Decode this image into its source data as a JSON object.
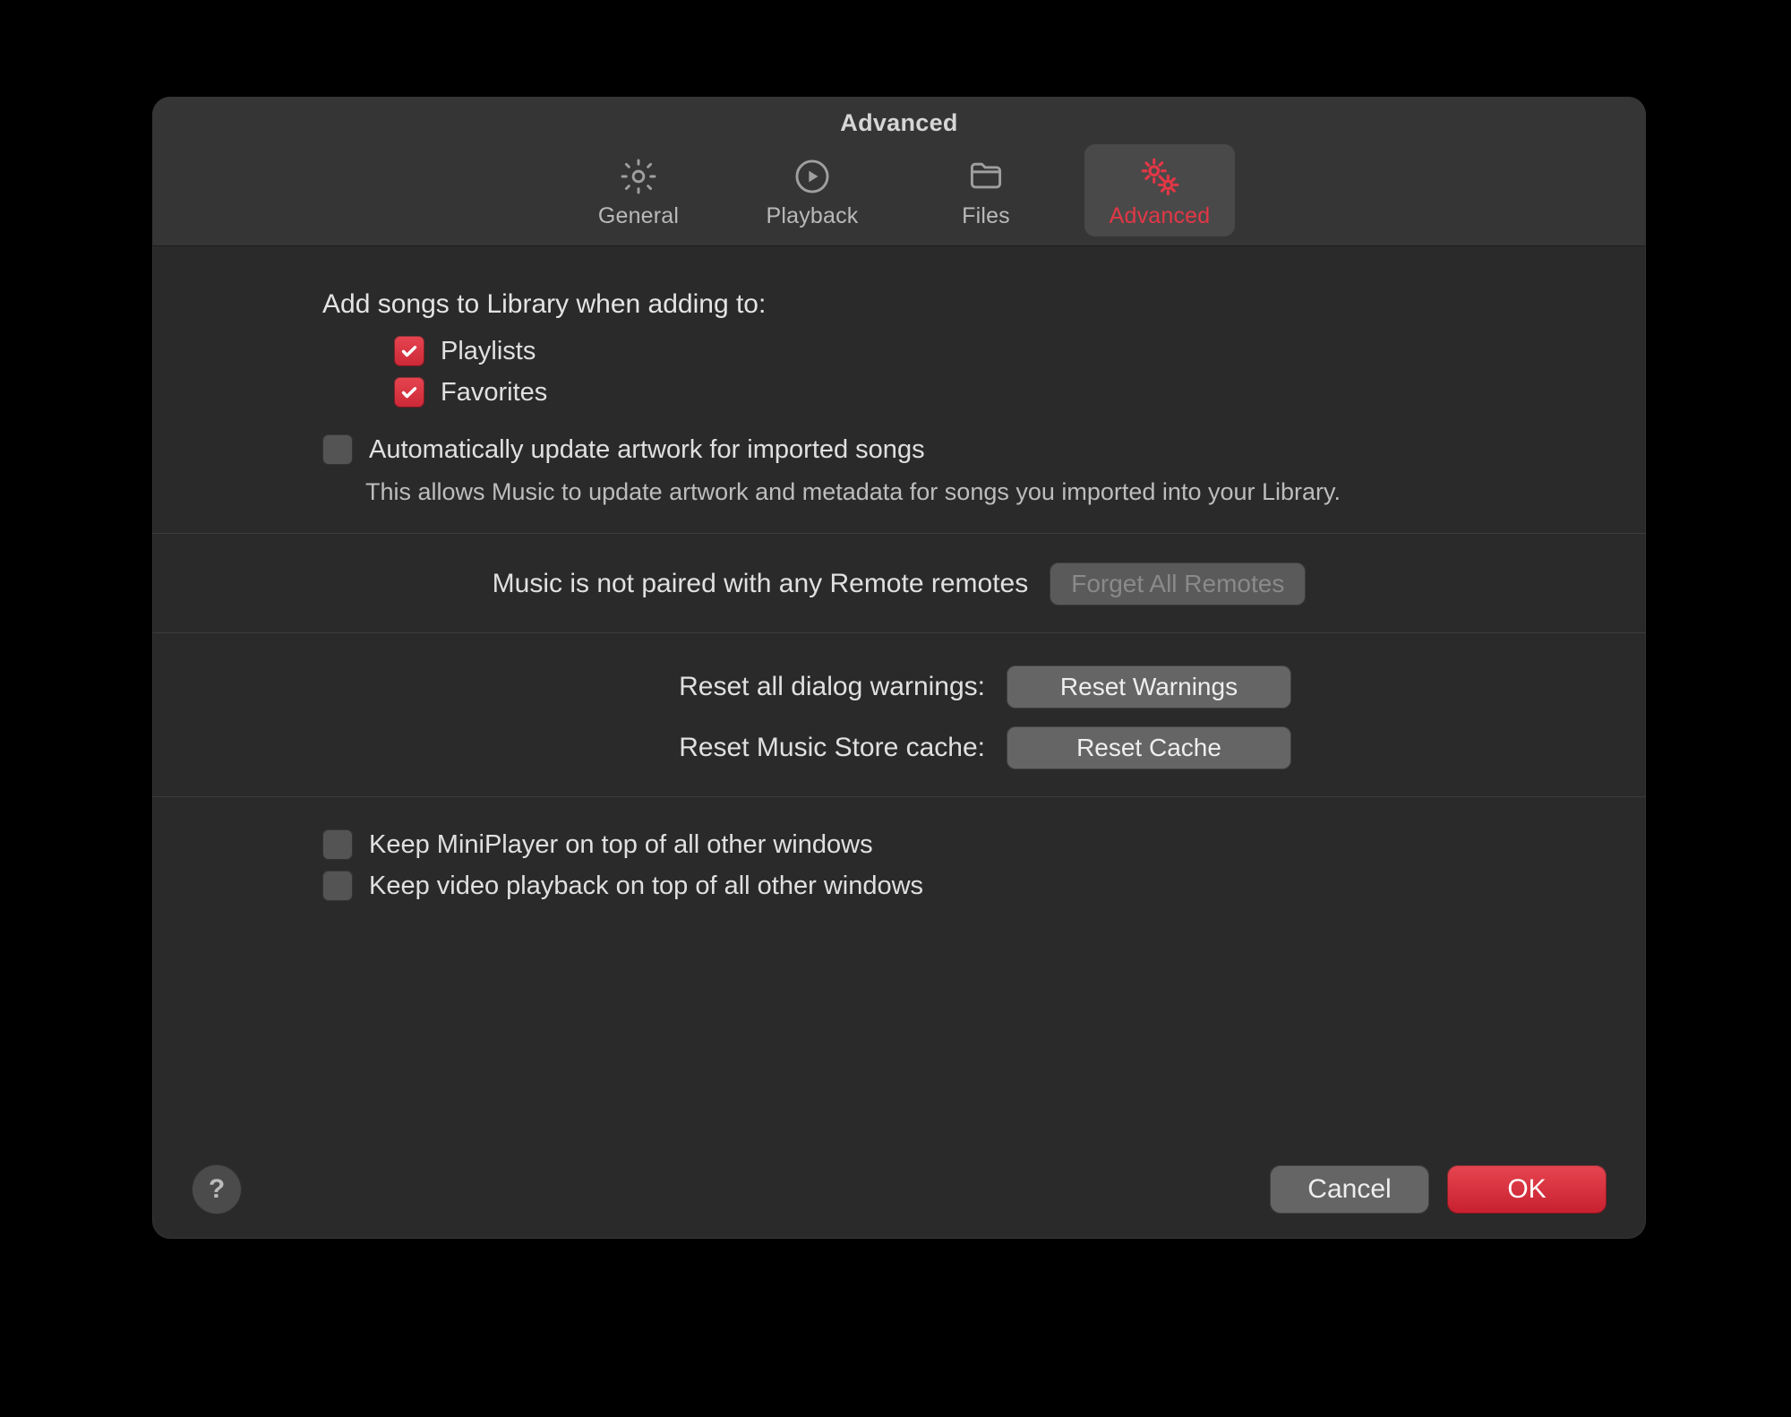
{
  "window": {
    "title": "Advanced"
  },
  "tabs": [
    {
      "label": "General"
    },
    {
      "label": "Playback"
    },
    {
      "label": "Files"
    },
    {
      "label": "Advanced",
      "active": true
    }
  ],
  "addSongs": {
    "heading": "Add songs to Library when adding to:",
    "cb_playlists": {
      "label": "Playlists",
      "checked": true
    },
    "cb_favorites": {
      "label": "Favorites",
      "checked": true
    }
  },
  "autoArtwork": {
    "label": "Automatically update artwork for imported songs",
    "checked": false,
    "description": "This allows Music to update artwork and metadata for songs you imported into your Library."
  },
  "remotes": {
    "text": "Music is not paired with any Remote remotes",
    "button": "Forget All Remotes",
    "buttonEnabled": false
  },
  "resets": {
    "warnings_label": "Reset all dialog warnings:",
    "warnings_button": "Reset Warnings",
    "cache_label": "Reset Music Store cache:",
    "cache_button": "Reset Cache"
  },
  "keepOnTop": {
    "miniPlayer": {
      "label": "Keep MiniPlayer on top of all other windows",
      "checked": false
    },
    "video": {
      "label": "Keep video playback on top of all other windows",
      "checked": false
    }
  },
  "footer": {
    "help": "?",
    "cancel": "Cancel",
    "ok": "OK"
  }
}
